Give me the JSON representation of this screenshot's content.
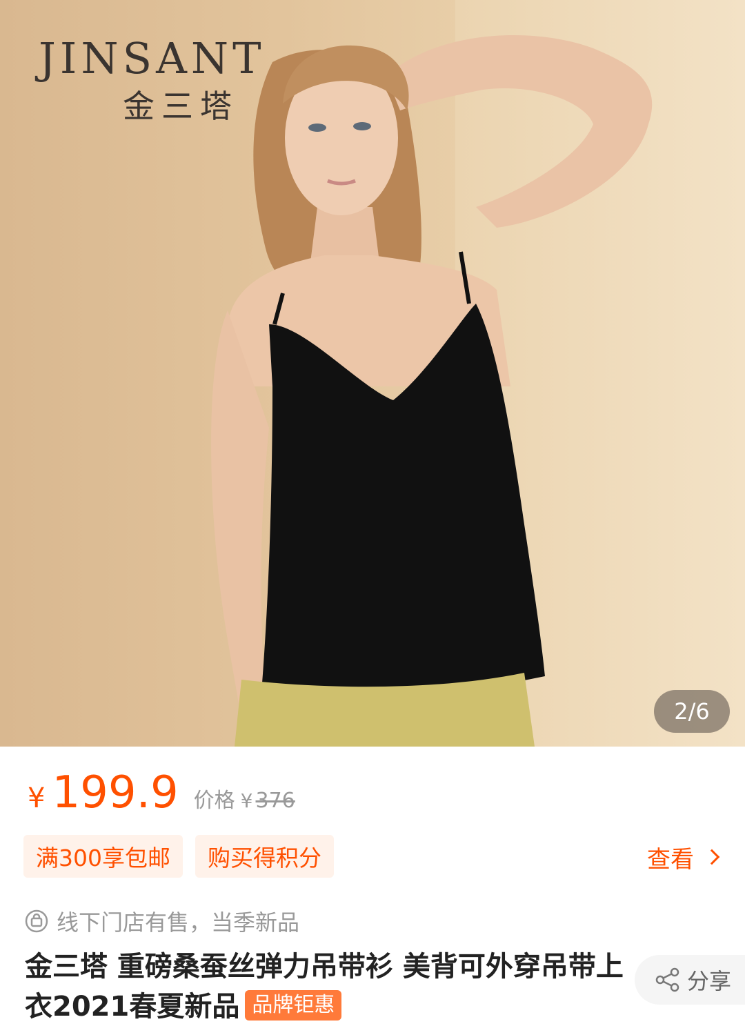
{
  "hero": {
    "brand_en": "JINSANT",
    "brand_cn": "金三塔",
    "image_counter": "2/6"
  },
  "price": {
    "symbol": "¥",
    "current": "199.9",
    "original_label": "价格",
    "original_symbol": "¥",
    "original": "376"
  },
  "promos": [
    {
      "label": "满300享包邮"
    },
    {
      "label": "购买得积分"
    }
  ],
  "view_more": "查看",
  "store_note": "线下门店有售，当季新品",
  "title": {
    "text": "金三塔 重磅桑蚕丝弹力吊带衫 美背可外穿吊带上衣2021春夏新品",
    "badge": "品牌钜惠"
  },
  "share_label": "分享",
  "colors": {
    "accent": "#ff5000",
    "promo_bg": "#fff2ea",
    "badge_bg": "#ff7a3a",
    "hero_bg": "#e2c49c"
  },
  "icons": [
    "shopping-bag-icon",
    "share-icon",
    "chevron-right-icon"
  ]
}
